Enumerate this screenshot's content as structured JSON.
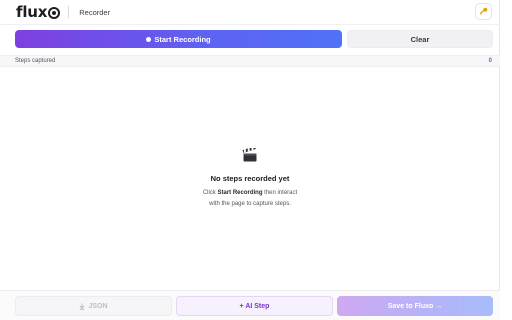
{
  "header": {
    "logo_text": "flux",
    "title": "Recorder",
    "settings_icon": "key-icon"
  },
  "actions": {
    "start_label": "Start Recording",
    "clear_label": "Clear"
  },
  "steps": {
    "label": "Steps captured",
    "count": "0"
  },
  "empty_state": {
    "icon": "clapperboard-icon",
    "title": "No steps recorded yet",
    "text_prefix": "Click ",
    "text_bold": "Start Recording",
    "text_suffix": " then interact",
    "text_line2": "with the page to capture steps."
  },
  "footer": {
    "json_icon": "download-icon",
    "json_label": "JSON",
    "ai_label": "+ AI Step",
    "save_label": "Save to Fluxo →"
  },
  "colors": {
    "accent_start": "#7e3fe0",
    "accent_end": "#4f72f7",
    "ai_purple": "#7a36c9",
    "count_blue": "#5860ee"
  }
}
